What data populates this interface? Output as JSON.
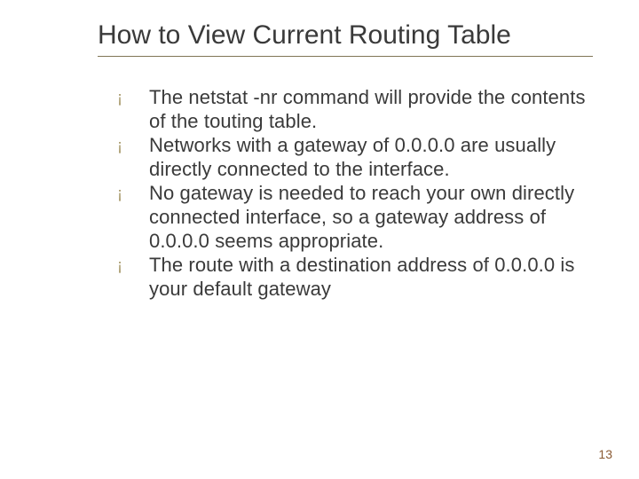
{
  "slide": {
    "title": "How to View Current Routing Table",
    "bullets": [
      {
        "marker": "¡",
        "text": "The netstat -nr command will provide the contents of the touting table."
      },
      {
        "marker": "¡",
        "text": "Networks with a gateway of 0.0.0.0 are usually directly connected to the interface."
      },
      {
        "marker": "¡",
        "text": "No gateway is needed to reach your own directly connected interface, so a gateway address of 0.0.0.0 seems appropriate."
      },
      {
        "marker": "¡",
        "text": " The route with a destination address of 0.0.0.0 is your default gateway"
      }
    ],
    "page_number": "13"
  }
}
